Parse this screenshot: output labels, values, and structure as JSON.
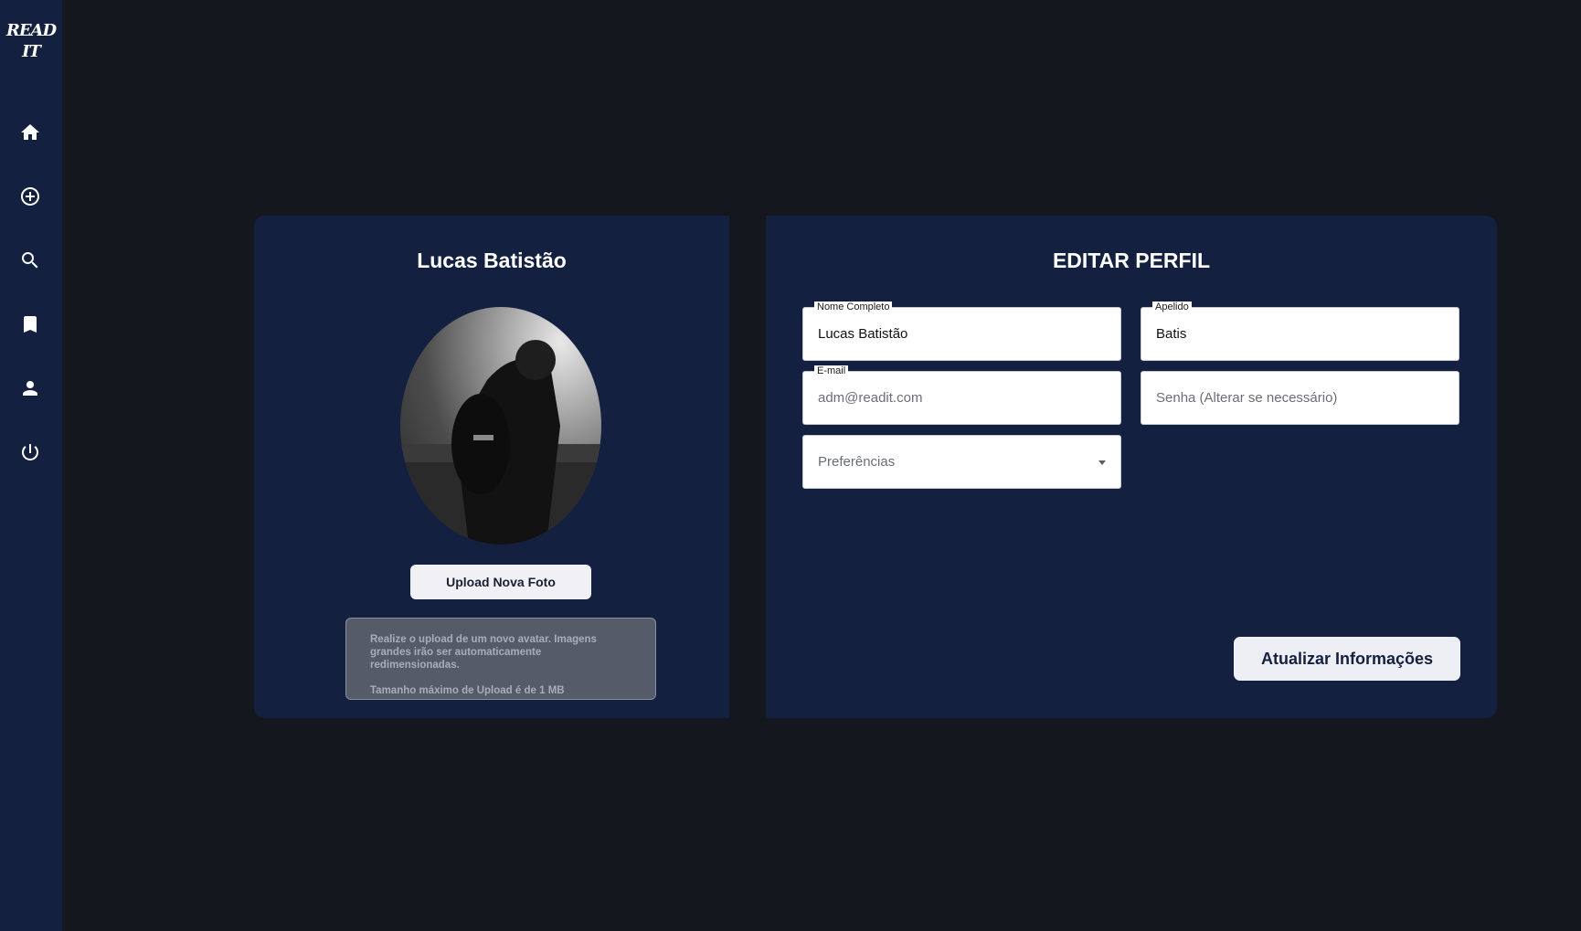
{
  "sidebar": {
    "logo_line1": "READ",
    "logo_line2": "IT",
    "items": [
      {
        "icon": "home-icon"
      },
      {
        "icon": "add-circle-icon"
      },
      {
        "icon": "search-icon"
      },
      {
        "icon": "bookmark-icon"
      },
      {
        "icon": "person-icon"
      },
      {
        "icon": "power-icon"
      }
    ]
  },
  "profile": {
    "name": "Lucas Batistão",
    "upload_button": "Upload Nova Foto",
    "info_line1": "Realize o upload de um novo avatar. Imagens grandes irão ser automaticamente redimensionadas.",
    "info_line2": "Tamanho máximo de Upload é de 1 MB"
  },
  "form": {
    "title": "EDITAR PERFIL",
    "full_name": {
      "label": "Nome Completo",
      "value": "Lucas Batistão"
    },
    "nickname": {
      "label": "Apelido",
      "value": "Batis"
    },
    "email": {
      "label": "E-mail",
      "placeholder": "adm@readit.com"
    },
    "password": {
      "placeholder": "Senha (Alterar se necessário)"
    },
    "preferences": {
      "placeholder": "Preferências"
    },
    "submit": "Atualizar Informações"
  },
  "colors": {
    "background": "#14171e",
    "panel": "#13203f",
    "button": "#f0f0f5"
  }
}
